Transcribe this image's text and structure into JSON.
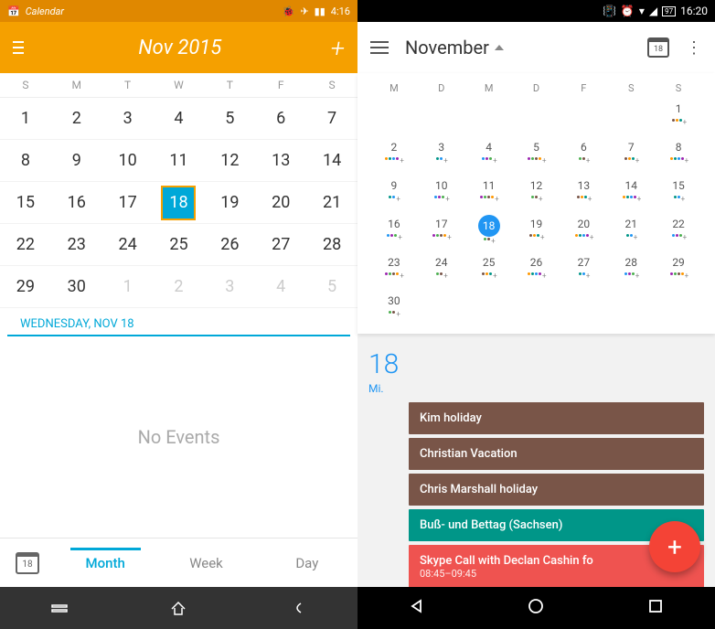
{
  "left": {
    "status": {
      "app": "Calendar",
      "time": "4:16"
    },
    "header": {
      "title": "Nov 2015"
    },
    "dow": [
      "S",
      "M",
      "T",
      "W",
      "T",
      "F",
      "S"
    ],
    "grid": [
      [
        1,
        2,
        3,
        4,
        5,
        6,
        7
      ],
      [
        8,
        9,
        10,
        11,
        12,
        13,
        14
      ],
      [
        15,
        16,
        17,
        18,
        19,
        20,
        21
      ],
      [
        22,
        23,
        24,
        25,
        26,
        27,
        28
      ],
      [
        29,
        30,
        1,
        2,
        3,
        4,
        5
      ]
    ],
    "selected_day": 18,
    "dim_start_row": 4,
    "dim_start_col": 2,
    "selected_date_label": "WEDNESDAY, NOV 18",
    "no_events": "No Events",
    "today_icon_day": "18",
    "tabs": [
      "Month",
      "Week",
      "Day"
    ],
    "active_tab": 0
  },
  "right": {
    "status": {
      "time": "16:20",
      "batt": "97"
    },
    "header": {
      "title": "November",
      "today_icon_day": "18"
    },
    "dow": [
      "M",
      "D",
      "M",
      "D",
      "F",
      "S",
      "S"
    ],
    "grid": [
      {
        "offset": 6,
        "days": [
          1
        ]
      },
      {
        "offset": 0,
        "days": [
          2,
          3,
          4,
          5,
          6,
          7,
          8
        ]
      },
      {
        "offset": 0,
        "days": [
          9,
          10,
          11,
          12,
          13,
          14,
          15
        ]
      },
      {
        "offset": 0,
        "days": [
          16,
          17,
          18,
          19,
          20,
          21,
          22
        ]
      },
      {
        "offset": 0,
        "days": [
          23,
          24,
          25,
          26,
          27,
          28,
          29
        ]
      },
      {
        "offset": 0,
        "days": [
          30
        ]
      }
    ],
    "selected_day": 18,
    "day_label": {
      "num": "18",
      "wd": "Mi."
    },
    "events": [
      {
        "title": "Kim holiday",
        "color": "brown"
      },
      {
        "title": "Christian Vacation",
        "color": "brown"
      },
      {
        "title": "Chris Marshall holiday",
        "color": "brown"
      },
      {
        "title": "Buß- und Bettag (Sachsen)",
        "color": "teal"
      },
      {
        "title": "Skype Call with Declan Cashin fo",
        "sub": "08:45–09:45",
        "color": "red"
      }
    ]
  }
}
